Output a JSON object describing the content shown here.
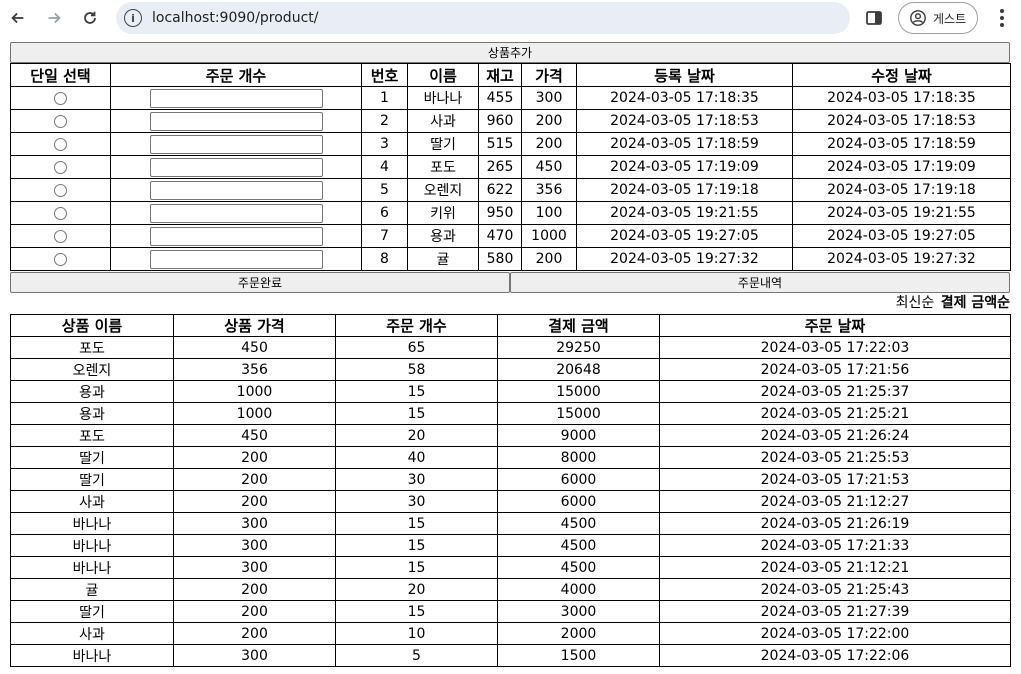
{
  "browser": {
    "url": "localhost:9090/product/",
    "profile_label": "게스트"
  },
  "product_section": {
    "add_button": "상품추가",
    "headers": [
      "단일 선택",
      "주문 개수",
      "번호",
      "이름",
      "재고",
      "가격",
      "등록 날짜",
      "수정 날짜"
    ],
    "rows": [
      {
        "no": "1",
        "name": "바나나",
        "stock": "455",
        "price": "300",
        "created": "2024-03-05 17:18:35",
        "updated": "2024-03-05 17:18:35"
      },
      {
        "no": "2",
        "name": "사과",
        "stock": "960",
        "price": "200",
        "created": "2024-03-05 17:18:53",
        "updated": "2024-03-05 17:18:53"
      },
      {
        "no": "3",
        "name": "딸기",
        "stock": "515",
        "price": "200",
        "created": "2024-03-05 17:18:59",
        "updated": "2024-03-05 17:18:59"
      },
      {
        "no": "4",
        "name": "포도",
        "stock": "265",
        "price": "450",
        "created": "2024-03-05 17:19:09",
        "updated": "2024-03-05 17:19:09"
      },
      {
        "no": "5",
        "name": "오렌지",
        "stock": "622",
        "price": "356",
        "created": "2024-03-05 17:19:18",
        "updated": "2024-03-05 17:19:18"
      },
      {
        "no": "6",
        "name": "키위",
        "stock": "950",
        "price": "100",
        "created": "2024-03-05 19:21:55",
        "updated": "2024-03-05 19:21:55"
      },
      {
        "no": "7",
        "name": "용과",
        "stock": "470",
        "price": "1000",
        "created": "2024-03-05 19:27:05",
        "updated": "2024-03-05 19:27:05"
      },
      {
        "no": "8",
        "name": "귤",
        "stock": "580",
        "price": "200",
        "created": "2024-03-05 19:27:32",
        "updated": "2024-03-05 19:27:32"
      }
    ],
    "complete_button": "주문완료",
    "history_button": "주문내역"
  },
  "sort": {
    "latest": "최신순",
    "amount": "결제 금액순"
  },
  "order_section": {
    "headers": [
      "상품 이름",
      "상품 가격",
      "주문 개수",
      "결제 금액",
      "주문 날짜"
    ],
    "rows": [
      [
        "포도",
        "450",
        "65",
        "29250",
        "2024-03-05 17:22:03"
      ],
      [
        "오렌지",
        "356",
        "58",
        "20648",
        "2024-03-05 17:21:56"
      ],
      [
        "용과",
        "1000",
        "15",
        "15000",
        "2024-03-05 21:25:37"
      ],
      [
        "용과",
        "1000",
        "15",
        "15000",
        "2024-03-05 21:25:21"
      ],
      [
        "포도",
        "450",
        "20",
        "9000",
        "2024-03-05 21:26:24"
      ],
      [
        "딸기",
        "200",
        "40",
        "8000",
        "2024-03-05 21:25:53"
      ],
      [
        "딸기",
        "200",
        "30",
        "6000",
        "2024-03-05 17:21:53"
      ],
      [
        "사과",
        "200",
        "30",
        "6000",
        "2024-03-05 21:12:27"
      ],
      [
        "바나나",
        "300",
        "15",
        "4500",
        "2024-03-05 21:26:19"
      ],
      [
        "바나나",
        "300",
        "15",
        "4500",
        "2024-03-05 17:21:33"
      ],
      [
        "바나나",
        "300",
        "15",
        "4500",
        "2024-03-05 21:12:21"
      ],
      [
        "귤",
        "200",
        "20",
        "4000",
        "2024-03-05 21:25:43"
      ],
      [
        "딸기",
        "200",
        "15",
        "3000",
        "2024-03-05 21:27:39"
      ],
      [
        "사과",
        "200",
        "10",
        "2000",
        "2024-03-05 17:22:00"
      ],
      [
        "바나나",
        "300",
        "5",
        "1500",
        "2024-03-05 17:22:06"
      ]
    ]
  }
}
